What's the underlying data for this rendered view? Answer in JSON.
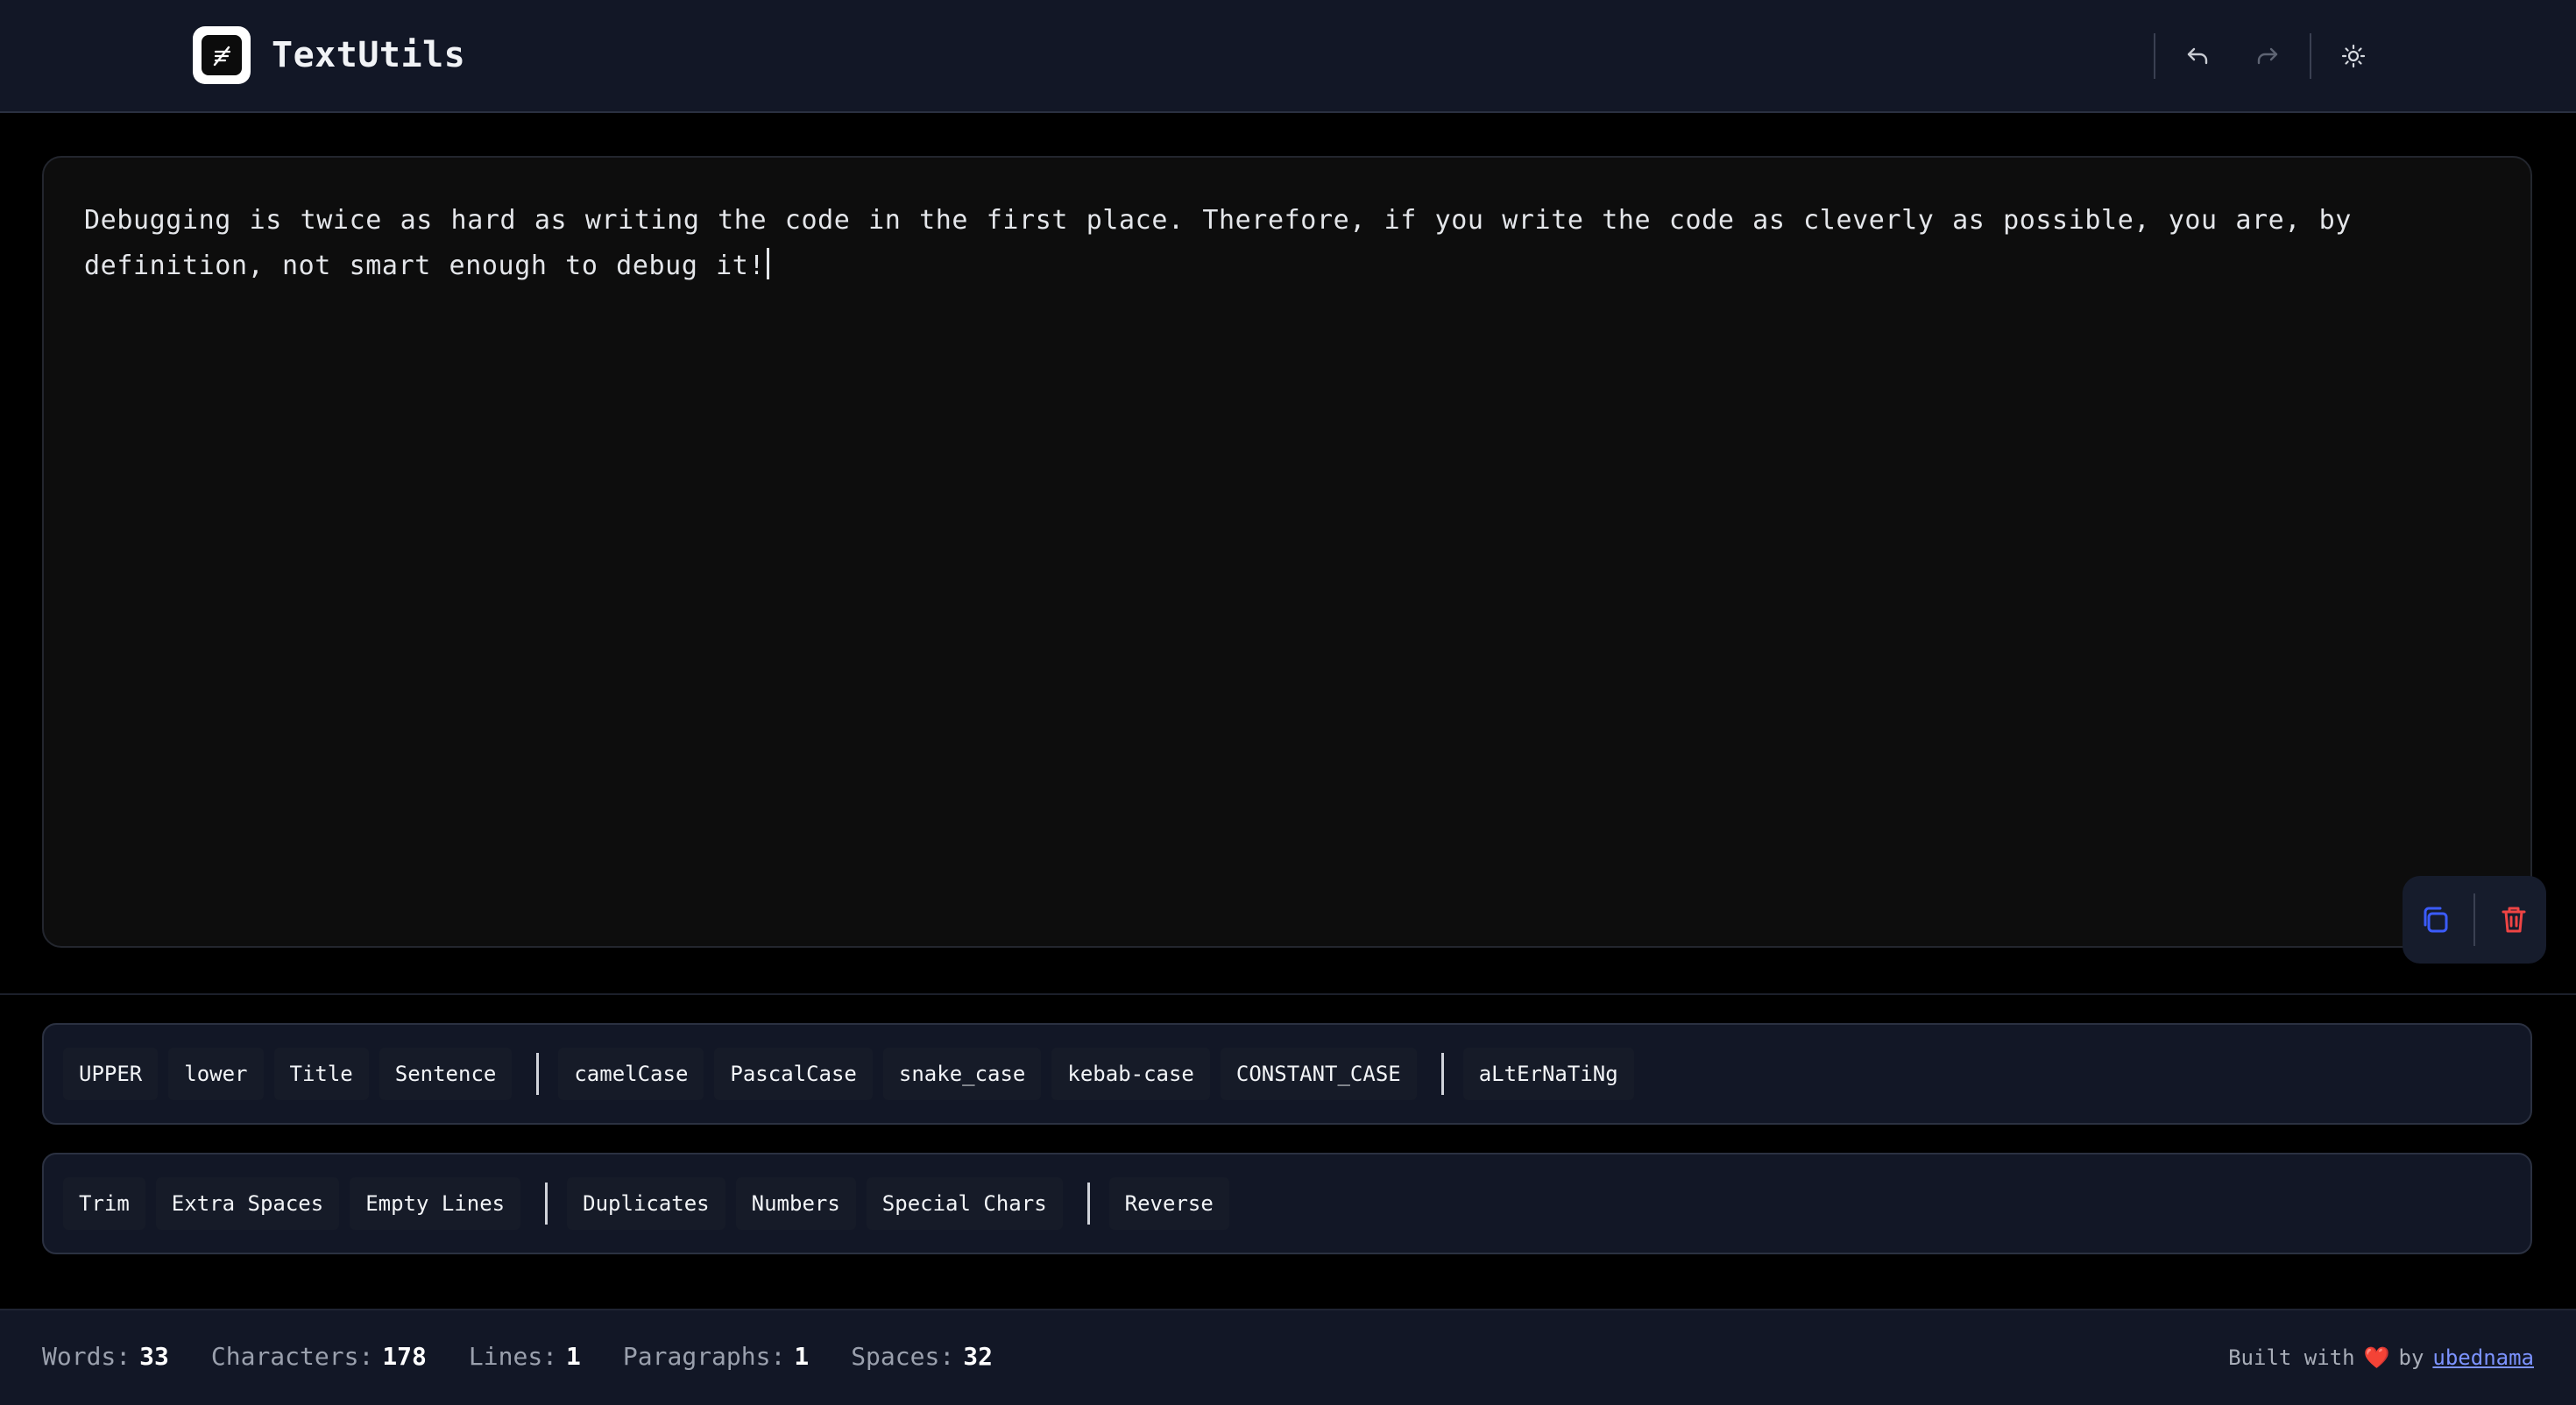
{
  "header": {
    "app_title": "TextUtils",
    "logo_icon": "feather-icon",
    "buttons": {
      "undo_icon": "undo-icon",
      "redo_icon": "redo-icon",
      "theme_icon": "sun-icon"
    }
  },
  "editor": {
    "text": "Debugging is twice as hard as writing the code in the first place. Therefore, if you write the code as cleverly as possible, you are, by definition, not smart enough to debug it!",
    "copy_icon": "copy-icon",
    "delete_icon": "trash-icon"
  },
  "case_toolbar": {
    "group1": [
      "UPPER",
      "lower",
      "Title",
      "Sentence"
    ],
    "group2": [
      "camelCase",
      "PascalCase",
      "snake_case",
      "kebab-case",
      "CONSTANT_CASE"
    ],
    "group3": [
      "aLtErNaTiNg"
    ]
  },
  "clean_toolbar": {
    "group1": [
      "Trim",
      "Extra Spaces",
      "Empty Lines"
    ],
    "group2": [
      "Duplicates",
      "Numbers",
      "Special Chars"
    ],
    "group3": [
      "Reverse"
    ]
  },
  "footer": {
    "stats": [
      {
        "label": "Words:",
        "value": "33"
      },
      {
        "label": "Characters:",
        "value": "178"
      },
      {
        "label": "Lines:",
        "value": "1"
      },
      {
        "label": "Paragraphs:",
        "value": "1"
      },
      {
        "label": "Spaces:",
        "value": "32"
      }
    ],
    "credit_prefix": "Built with",
    "credit_heart": "❤️",
    "credit_by": "by",
    "author": "ubednama"
  },
  "colors": {
    "accent_blue": "#3b5bfd",
    "danger_red": "#ef4444",
    "header_bg": "#121726"
  }
}
